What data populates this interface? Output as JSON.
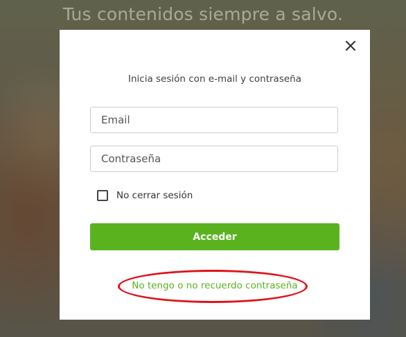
{
  "background": {
    "headline": "Tus contenidos siempre a salvo."
  },
  "login_modal": {
    "subtitle": "Inicia sesión con e-mail y contraseña",
    "close_icon": "close-icon",
    "email_placeholder": "Email",
    "password_placeholder": "Contraseña",
    "remember_label": "No cerrar sesión",
    "remember_checked": false,
    "submit_label": "Acceder",
    "forgot_link": "No tengo o no recuerdo contraseña"
  },
  "colors": {
    "accent_green": "#5ab31e",
    "annotation_red": "#e0121b"
  }
}
